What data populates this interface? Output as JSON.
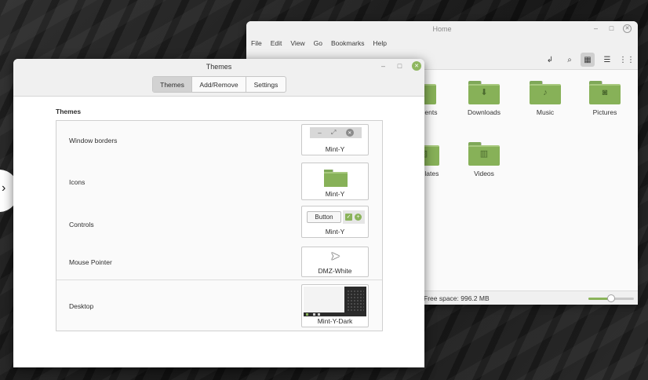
{
  "file_manager": {
    "title": "Home",
    "menu": [
      "File",
      "Edit",
      "View",
      "Go",
      "Bookmarks",
      "Help"
    ],
    "items": [
      {
        "label": "Documents",
        "icon": "document-folder-icon"
      },
      {
        "label": "Downloads",
        "icon": "download-folder-icon"
      },
      {
        "label": "Music",
        "icon": "music-folder-icon"
      },
      {
        "label": "Pictures",
        "icon": "pictures-folder-icon"
      },
      {
        "label": "Templates",
        "icon": "templates-folder-icon"
      },
      {
        "label": "Videos",
        "icon": "videos-folder-icon"
      }
    ],
    "status": "Free space: 996.2 MB",
    "zoom_level": 0.5,
    "active_view": "icon-view"
  },
  "themes": {
    "title": "Themes",
    "tabs": [
      "Themes",
      "Add/Remove",
      "Settings"
    ],
    "active_tab": "Themes",
    "section_title": "Themes",
    "rows": [
      {
        "label": "Window borders",
        "value": "Mint-Y"
      },
      {
        "label": "Icons",
        "value": "Mint-Y"
      },
      {
        "label": "Controls",
        "value": "Mint-Y",
        "button_label": "Button"
      },
      {
        "label": "Mouse Pointer",
        "value": "DMZ-White"
      },
      {
        "label": "Desktop",
        "value": "Mint-Y-Dark"
      }
    ]
  },
  "colors": {
    "accent_green": "#8ab35a",
    "folder_green": "#87b158",
    "window_bg": "#fafafa",
    "titlebar_bg": "#f0f0f0"
  }
}
